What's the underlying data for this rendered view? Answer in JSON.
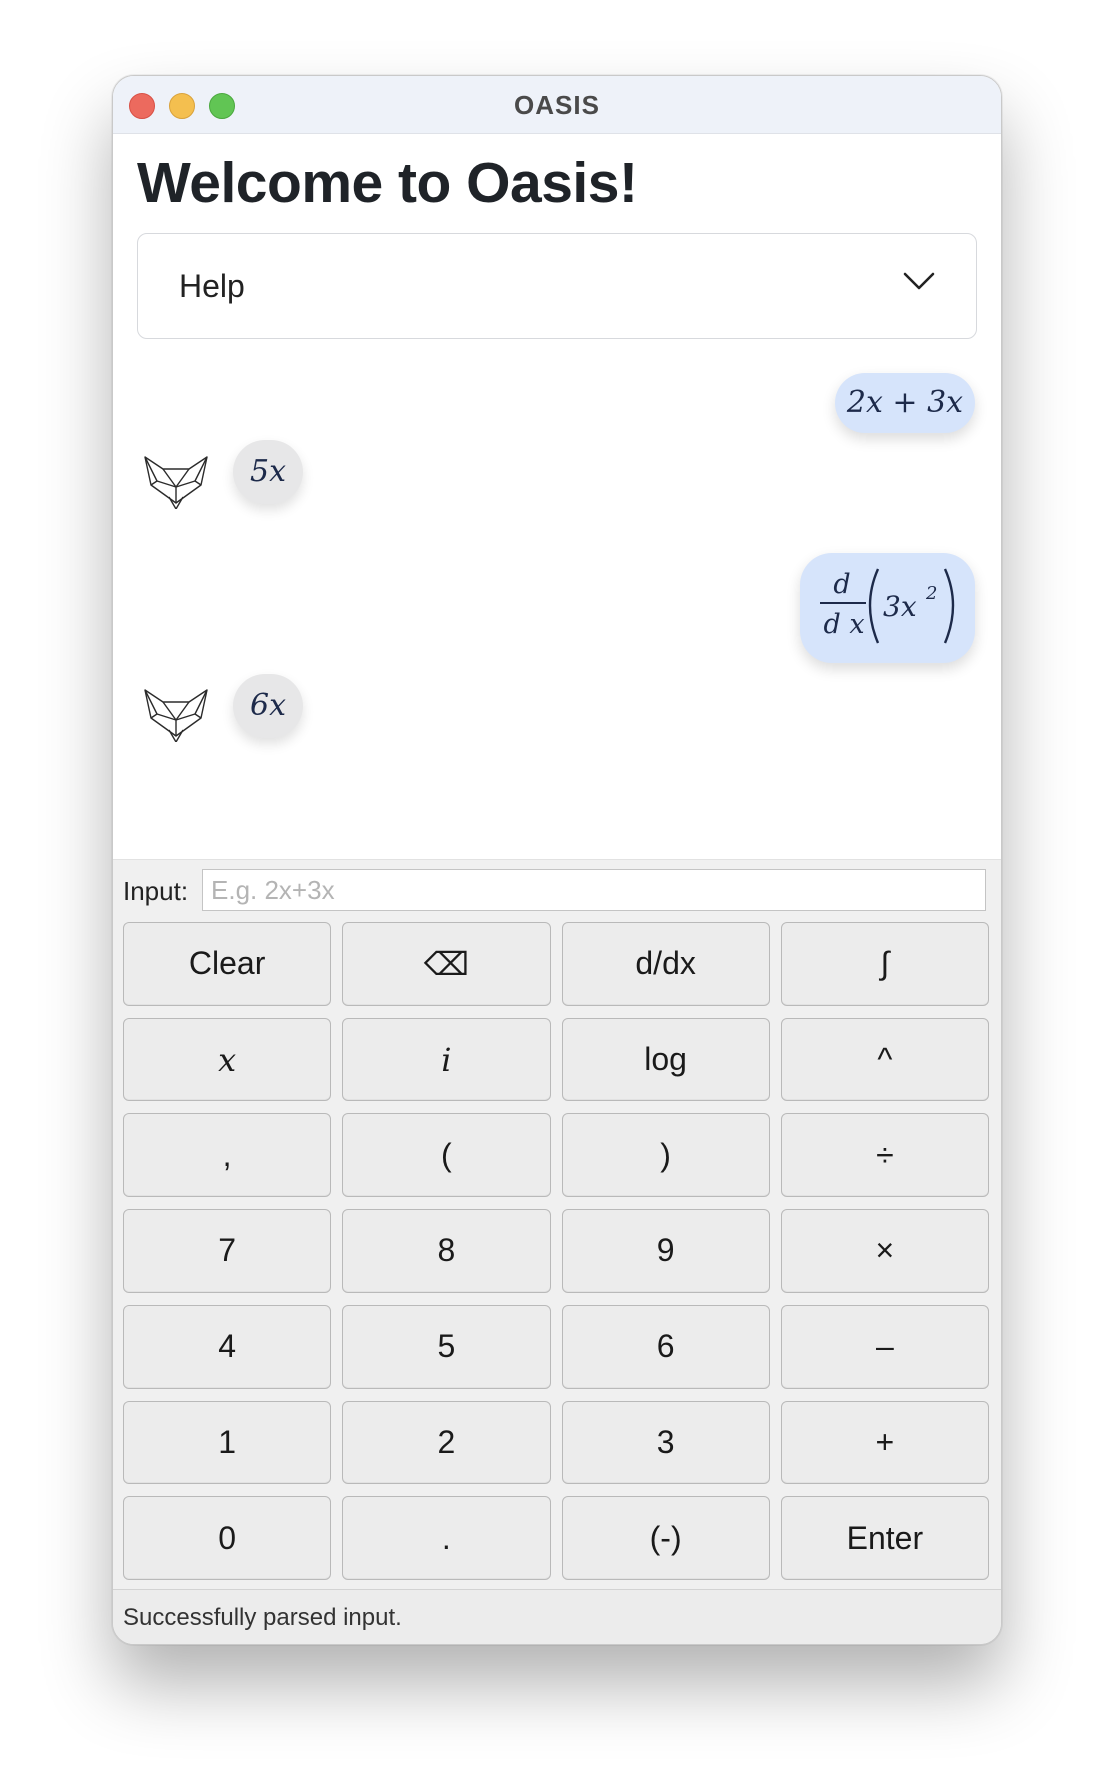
{
  "window": {
    "title": "OASIS"
  },
  "heading": "Welcome to Oasis!",
  "help": {
    "label": "Help"
  },
  "conversation": {
    "user_1": "2x + 3x",
    "bot_1": "5x",
    "user_2": {
      "numerator": "d",
      "denominator": "d x",
      "expression": "3x",
      "exponent": "2"
    },
    "bot_2": "6x"
  },
  "input": {
    "label": "Input:",
    "placeholder": "E.g. 2x+3x",
    "value": ""
  },
  "keys": [
    {
      "label": "Clear",
      "name": "key-clear"
    },
    {
      "label": "⌫",
      "name": "key-backspace"
    },
    {
      "label": "d/dx",
      "name": "key-derivative"
    },
    {
      "label": "∫",
      "name": "key-integral"
    },
    {
      "label": "x",
      "name": "key-x",
      "italic": true
    },
    {
      "label": "i",
      "name": "key-i",
      "italic": true
    },
    {
      "label": "log",
      "name": "key-log"
    },
    {
      "label": "^",
      "name": "key-power"
    },
    {
      "label": ",",
      "name": "key-comma"
    },
    {
      "label": "(",
      "name": "key-open-paren"
    },
    {
      "label": ")",
      "name": "key-close-paren"
    },
    {
      "label": "÷",
      "name": "key-divide"
    },
    {
      "label": "7",
      "name": "key-7"
    },
    {
      "label": "8",
      "name": "key-8"
    },
    {
      "label": "9",
      "name": "key-9"
    },
    {
      "label": "×",
      "name": "key-multiply"
    },
    {
      "label": "4",
      "name": "key-4"
    },
    {
      "label": "5",
      "name": "key-5"
    },
    {
      "label": "6",
      "name": "key-6"
    },
    {
      "label": "–",
      "name": "key-minus"
    },
    {
      "label": "1",
      "name": "key-1"
    },
    {
      "label": "2",
      "name": "key-2"
    },
    {
      "label": "3",
      "name": "key-3"
    },
    {
      "label": "+",
      "name": "key-plus"
    },
    {
      "label": "0",
      "name": "key-0"
    },
    {
      "label": ".",
      "name": "key-decimal"
    },
    {
      "label": "(-)",
      "name": "key-negate"
    },
    {
      "label": "Enter",
      "name": "key-enter"
    }
  ],
  "status": "Successfully parsed input.",
  "colors": {
    "user_bubble": "#d6e4fb",
    "bot_bubble": "#e7e7e8",
    "titlebar": "#eef2f9",
    "close": "#ec6a5e",
    "minimize": "#f4bf4f",
    "maximize": "#61c554"
  },
  "icons": {
    "help_toggle": "chevron-down-icon",
    "bot_avatar": "fox-icon",
    "backspace": "backspace-icon"
  }
}
